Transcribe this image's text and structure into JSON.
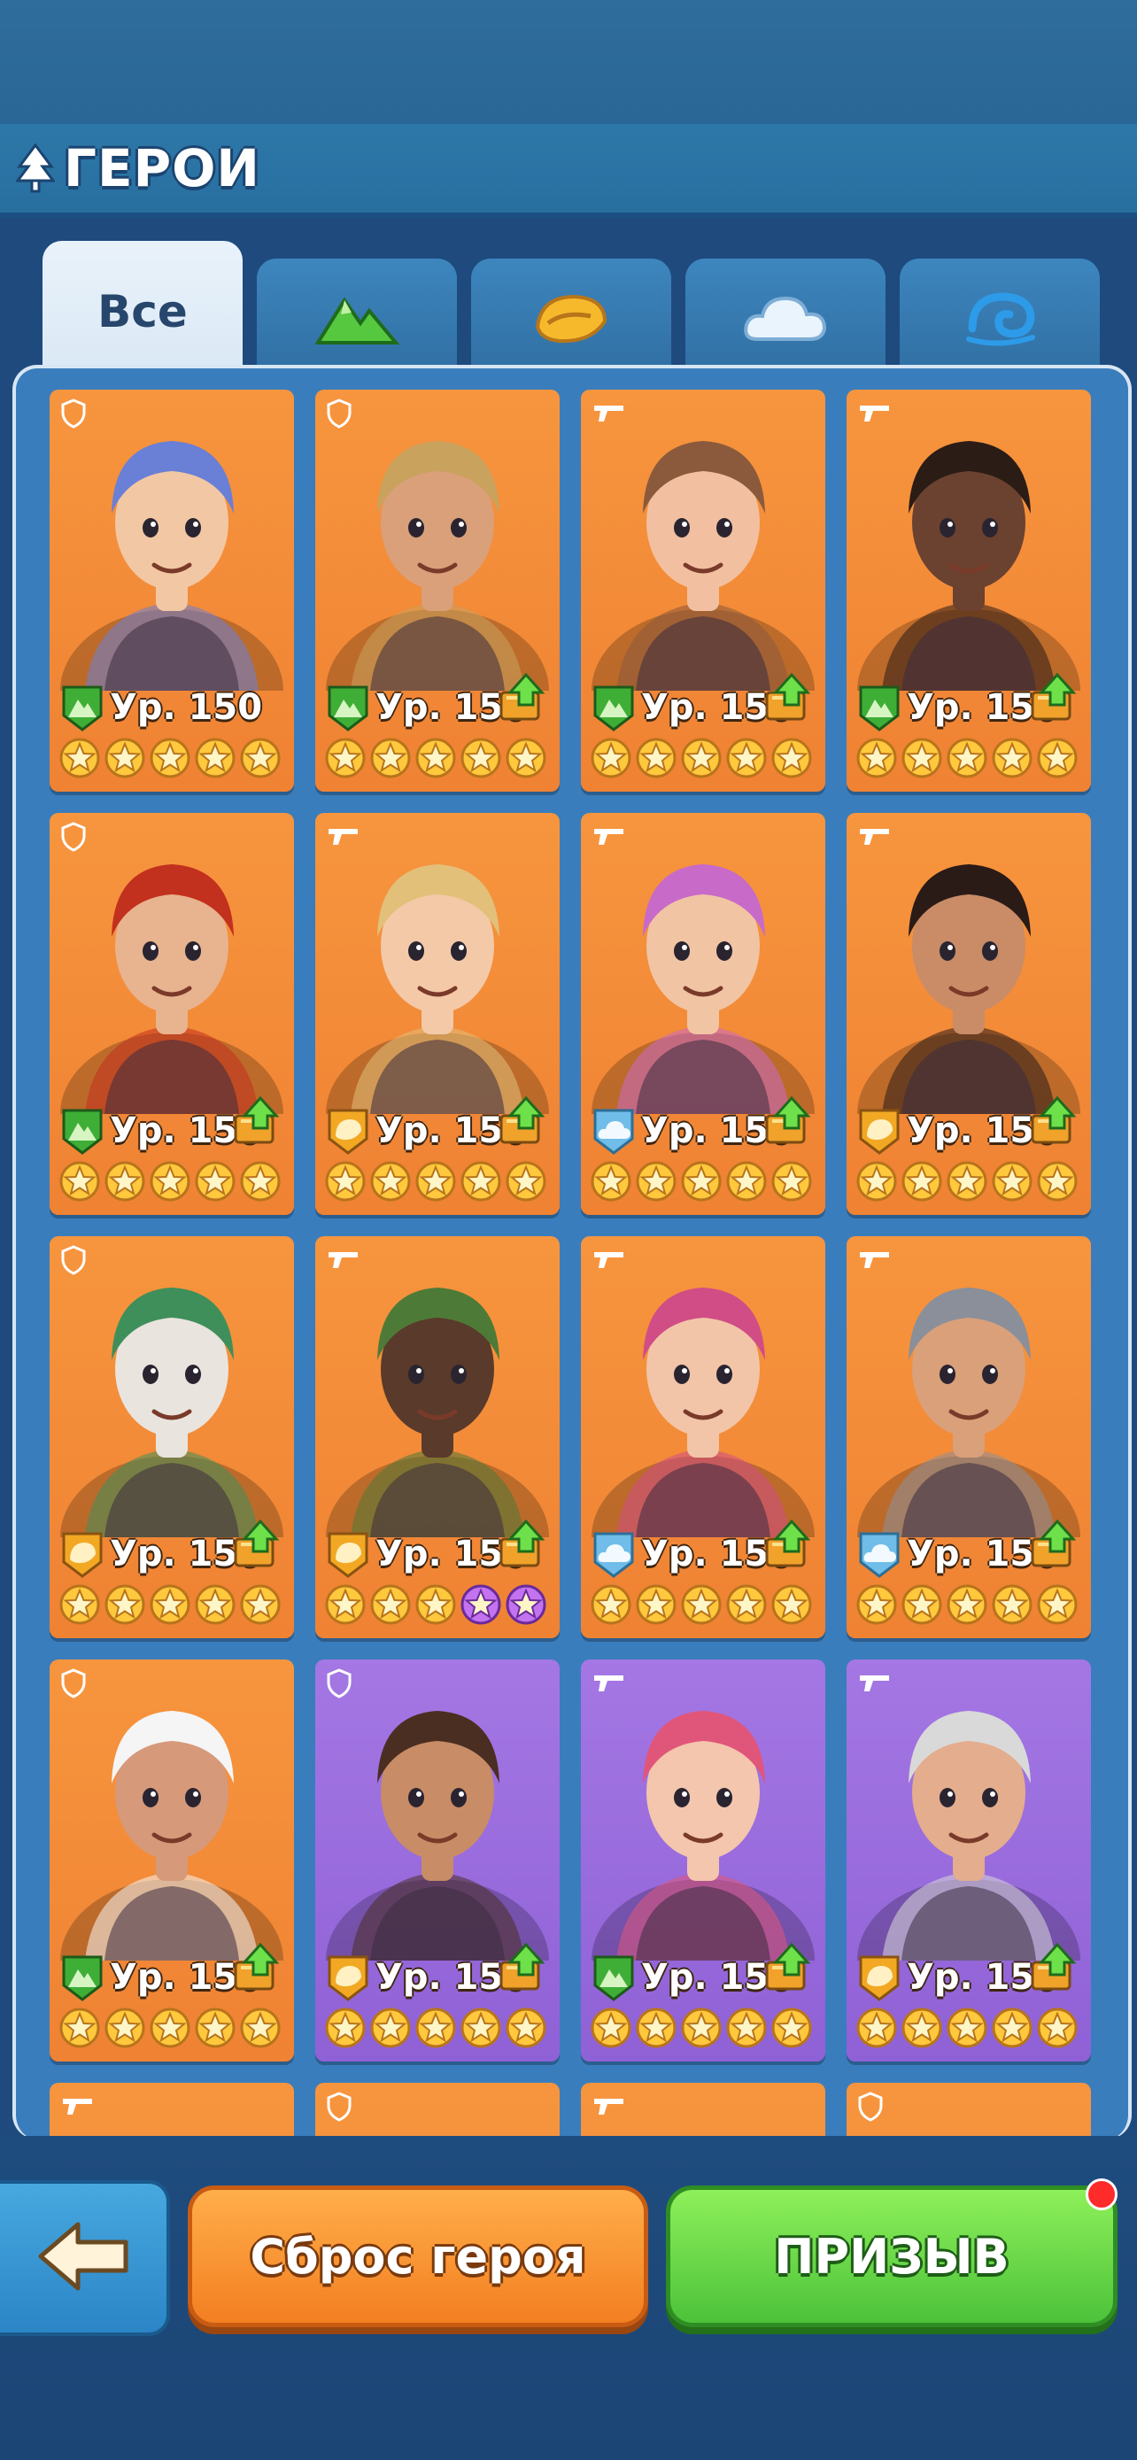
{
  "header": {
    "title": "ГЕРОИ"
  },
  "tabs": [
    {
      "label": "Все",
      "icon": "all",
      "active": true
    },
    {
      "label": "",
      "icon": "mountain-element-icon",
      "active": false
    },
    {
      "label": "",
      "icon": "sun-element-icon",
      "active": false
    },
    {
      "label": "",
      "icon": "cloud-element-icon",
      "active": false
    },
    {
      "label": "",
      "icon": "wave-element-icon",
      "active": false
    }
  ],
  "colors": {
    "card_orange": "#f58c3a",
    "card_purple": "#9a6ade",
    "mountain": "#4cbf3a",
    "sun": "#f4b32e",
    "cloud": "#7ec6ef",
    "star": "#ffc83d"
  },
  "heroes": [
    {
      "level": "Ур. 150",
      "element": "mountain",
      "class": "shield",
      "stars": 5,
      "upgrade": false,
      "rarity": "orange",
      "skin": "#f2c7a3",
      "hair": "#6a7fd6"
    },
    {
      "level": "Ур. 150",
      "element": "mountain",
      "class": "shield",
      "stars": 5,
      "upgrade": true,
      "rarity": "orange",
      "skin": "#d9a07a",
      "hair": "#c9a25d"
    },
    {
      "level": "Ур. 150",
      "element": "mountain",
      "class": "gun",
      "stars": 5,
      "upgrade": true,
      "rarity": "orange",
      "skin": "#f2c0a0",
      "hair": "#8b5a3c"
    },
    {
      "level": "Ур. 150",
      "element": "mountain",
      "class": "gun",
      "stars": 5,
      "upgrade": true,
      "rarity": "orange",
      "skin": "#6b4130",
      "hair": "#2b1c16"
    },
    {
      "level": "Ур. 150",
      "element": "mountain",
      "class": "shield",
      "stars": 5,
      "upgrade": true,
      "rarity": "orange",
      "skin": "#e8b38f",
      "hair": "#c2301e"
    },
    {
      "level": "Ур. 150",
      "element": "sun",
      "class": "gun",
      "stars": 5,
      "upgrade": true,
      "rarity": "orange",
      "skin": "#f3c9a8",
      "hair": "#e2c07a"
    },
    {
      "level": "Ур. 150",
      "element": "cloud",
      "class": "gun",
      "stars": 5,
      "upgrade": true,
      "rarity": "orange",
      "skin": "#f1c4a4",
      "hair": "#c86ac8"
    },
    {
      "level": "Ур. 150",
      "element": "sun",
      "class": "gun",
      "stars": 5,
      "upgrade": true,
      "rarity": "orange",
      "skin": "#c98c67",
      "hair": "#2a1b17"
    },
    {
      "level": "Ур. 150",
      "element": "sun",
      "class": "shield",
      "stars": 5,
      "upgrade": true,
      "rarity": "orange",
      "skin": "#e9e4de",
      "hair": "#3f8f5a"
    },
    {
      "level": "Ур. 150",
      "element": "sun",
      "class": "gun",
      "stars": 3,
      "purple_stars": 2,
      "upgrade": true,
      "rarity": "orange",
      "skin": "#5a3a2a",
      "hair": "#4e7a37"
    },
    {
      "level": "Ур. 150",
      "element": "cloud",
      "class": "gun",
      "stars": 5,
      "upgrade": true,
      "rarity": "orange",
      "skin": "#f2c5a8",
      "hair": "#d04d86"
    },
    {
      "level": "Ур. 150",
      "element": "cloud",
      "class": "gun",
      "stars": 5,
      "upgrade": true,
      "rarity": "orange",
      "skin": "#d9a07a",
      "hair": "#8a8f9a"
    },
    {
      "level": "Ур. 150",
      "element": "mountain",
      "class": "shield",
      "stars": 5,
      "upgrade": true,
      "rarity": "orange",
      "skin": "#d6997a",
      "hair": "#f5f5f5"
    },
    {
      "level": "Ур. 150",
      "element": "sun",
      "class": "shield",
      "stars": 5,
      "upgrade": true,
      "rarity": "purple",
      "skin": "#c88c66",
      "hair": "#4a2e22"
    },
    {
      "level": "Ур. 150",
      "element": "mountain",
      "class": "gun",
      "stars": 5,
      "upgrade": true,
      "rarity": "purple",
      "skin": "#f3c6ad",
      "hair": "#e0567a"
    },
    {
      "level": "Ур. 150",
      "element": "sun",
      "class": "gun",
      "stars": 5,
      "upgrade": true,
      "rarity": "purple",
      "skin": "#e3ad8e",
      "hair": "#d9d9d9"
    }
  ],
  "partial_row": [
    {
      "class": "gun",
      "rarity": "orange"
    },
    {
      "class": "shield",
      "rarity": "orange"
    },
    {
      "class": "gun",
      "rarity": "orange"
    },
    {
      "class": "shield",
      "rarity": "orange"
    }
  ],
  "footer": {
    "reset_label": "Сброс героя",
    "summon_label": "ПРИЗЫВ"
  }
}
